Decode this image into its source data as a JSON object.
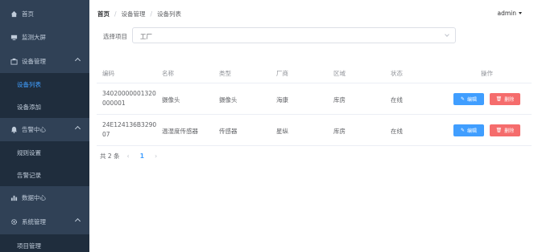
{
  "sidebar": {
    "items": [
      {
        "label": "首页",
        "icon": "home-icon"
      },
      {
        "label": "监测大屏",
        "icon": "monitor-icon"
      },
      {
        "label": "设备管理",
        "icon": "device-icon"
      },
      {
        "label": "设备列表"
      },
      {
        "label": "设备添加"
      },
      {
        "label": "告警中心",
        "icon": "bell-icon"
      },
      {
        "label": "规则设置"
      },
      {
        "label": "告警记录"
      },
      {
        "label": "数据中心",
        "icon": "chart-icon"
      },
      {
        "label": "系统管理",
        "icon": "gear-icon"
      },
      {
        "label": "项目管理"
      }
    ]
  },
  "breadcrumb": [
    "首页",
    "设备管理",
    "设备列表"
  ],
  "header": {
    "user": "admin"
  },
  "filter": {
    "label": "选择项目",
    "value": "工厂"
  },
  "table": {
    "headers": [
      "编码",
      "名称",
      "类型",
      "厂商",
      "区域",
      "状态",
      "操作"
    ],
    "rows": [
      {
        "code_line1": "34020000001320",
        "code_line2": "000001",
        "name": "摄像头",
        "type": "摄像头",
        "vendor": "海康",
        "area": "库房",
        "status": "在线"
      },
      {
        "code_line1": "24E124136B3290",
        "code_line2": "07",
        "name": "温湿度传感器",
        "type": "传感器",
        "vendor": "星纵",
        "area": "库房",
        "status": "在线"
      }
    ],
    "edit_label": "编辑",
    "delete_label": "删除"
  },
  "pagination": {
    "total": "共 2 条",
    "current": "1",
    "prev": "‹",
    "next": "›"
  },
  "colors": {
    "sidebar": "#304156",
    "submenu": "#1f2d3d",
    "accent": "#409eff",
    "danger": "#f56c6c"
  }
}
